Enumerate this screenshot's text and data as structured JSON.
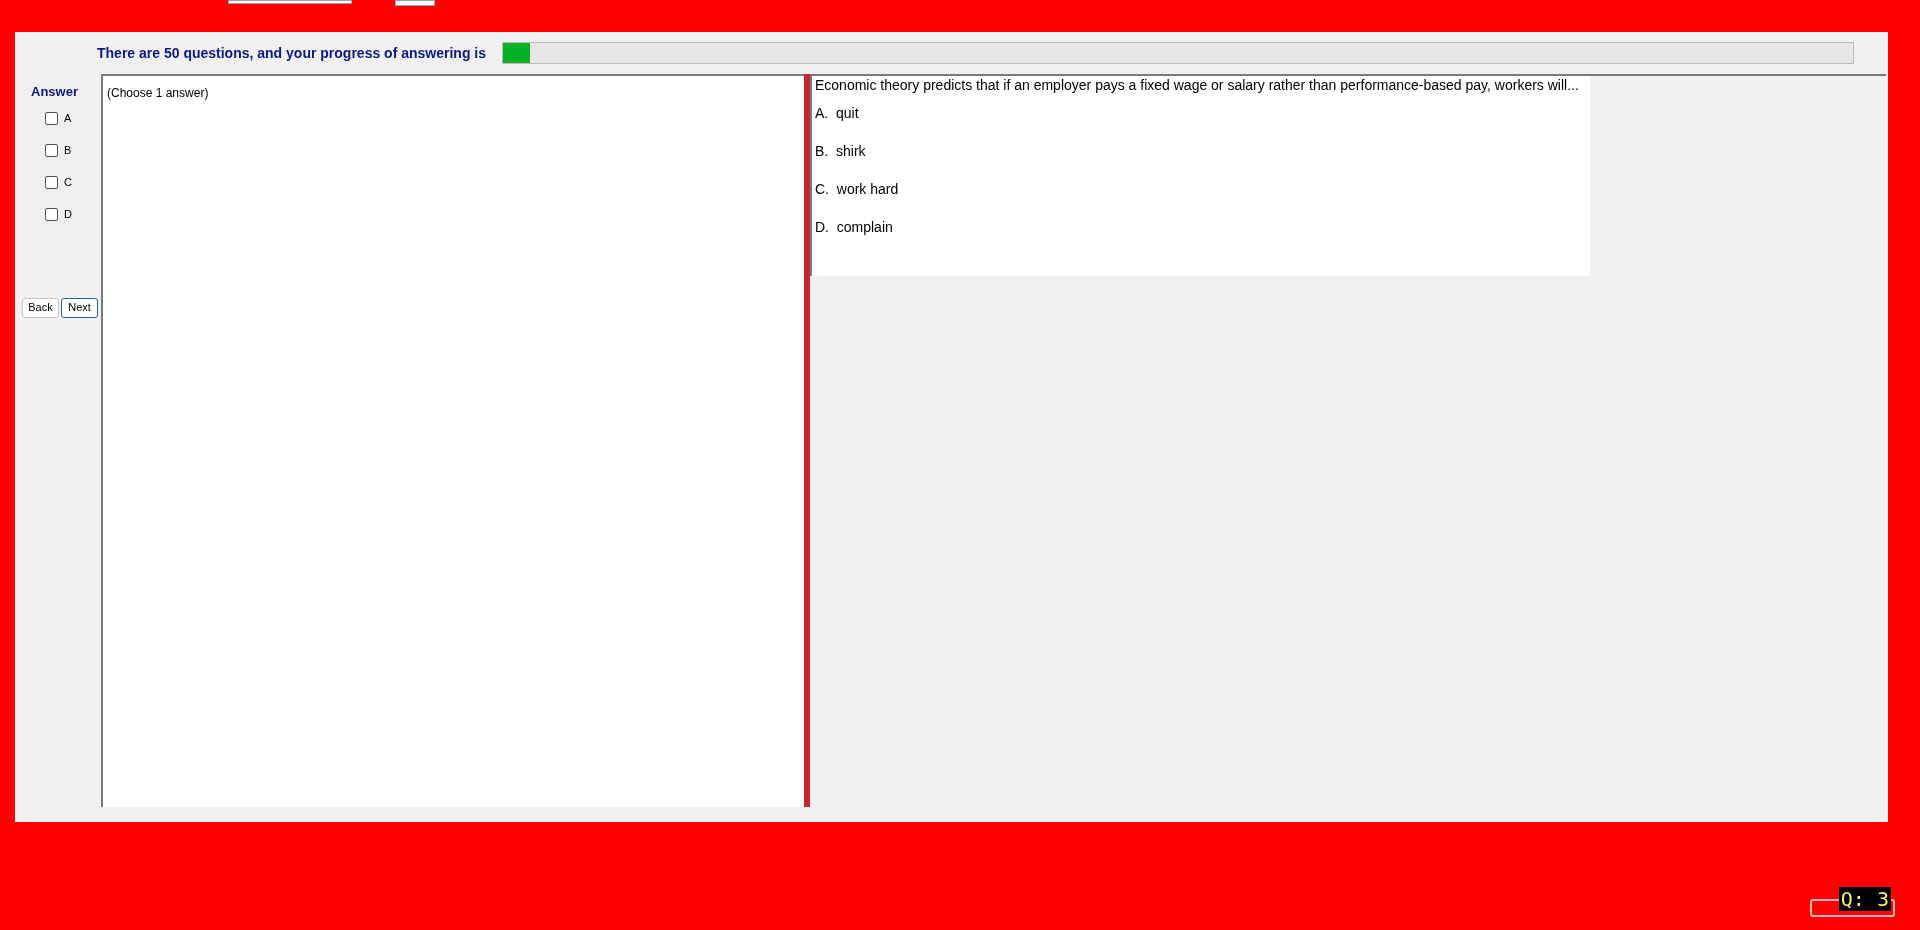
{
  "progress": {
    "label": "There are 50 questions, and your progress of answering is",
    "level": 0.02
  },
  "answer_panel": {
    "title": "Answer",
    "options": [
      {
        "label": "A",
        "checked": false
      },
      {
        "label": "B",
        "checked": false
      },
      {
        "label": "C",
        "checked": false
      },
      {
        "label": "D",
        "checked": false
      }
    ],
    "buttons": [
      {
        "label": "Back",
        "focused": false
      },
      {
        "label": "Next",
        "focused": true
      }
    ]
  },
  "answer_area": {
    "hint": "(Choose 1 answer)"
  },
  "question": {
    "text": "Economic theory predicts that if an employer pays a fixed wage or salary rather than performance-based pay, workers will...",
    "choices": [
      "A.  quit",
      "B.  shirk",
      "C.  work hard",
      "D.  complain"
    ]
  },
  "question_counter": "Q: 3"
}
